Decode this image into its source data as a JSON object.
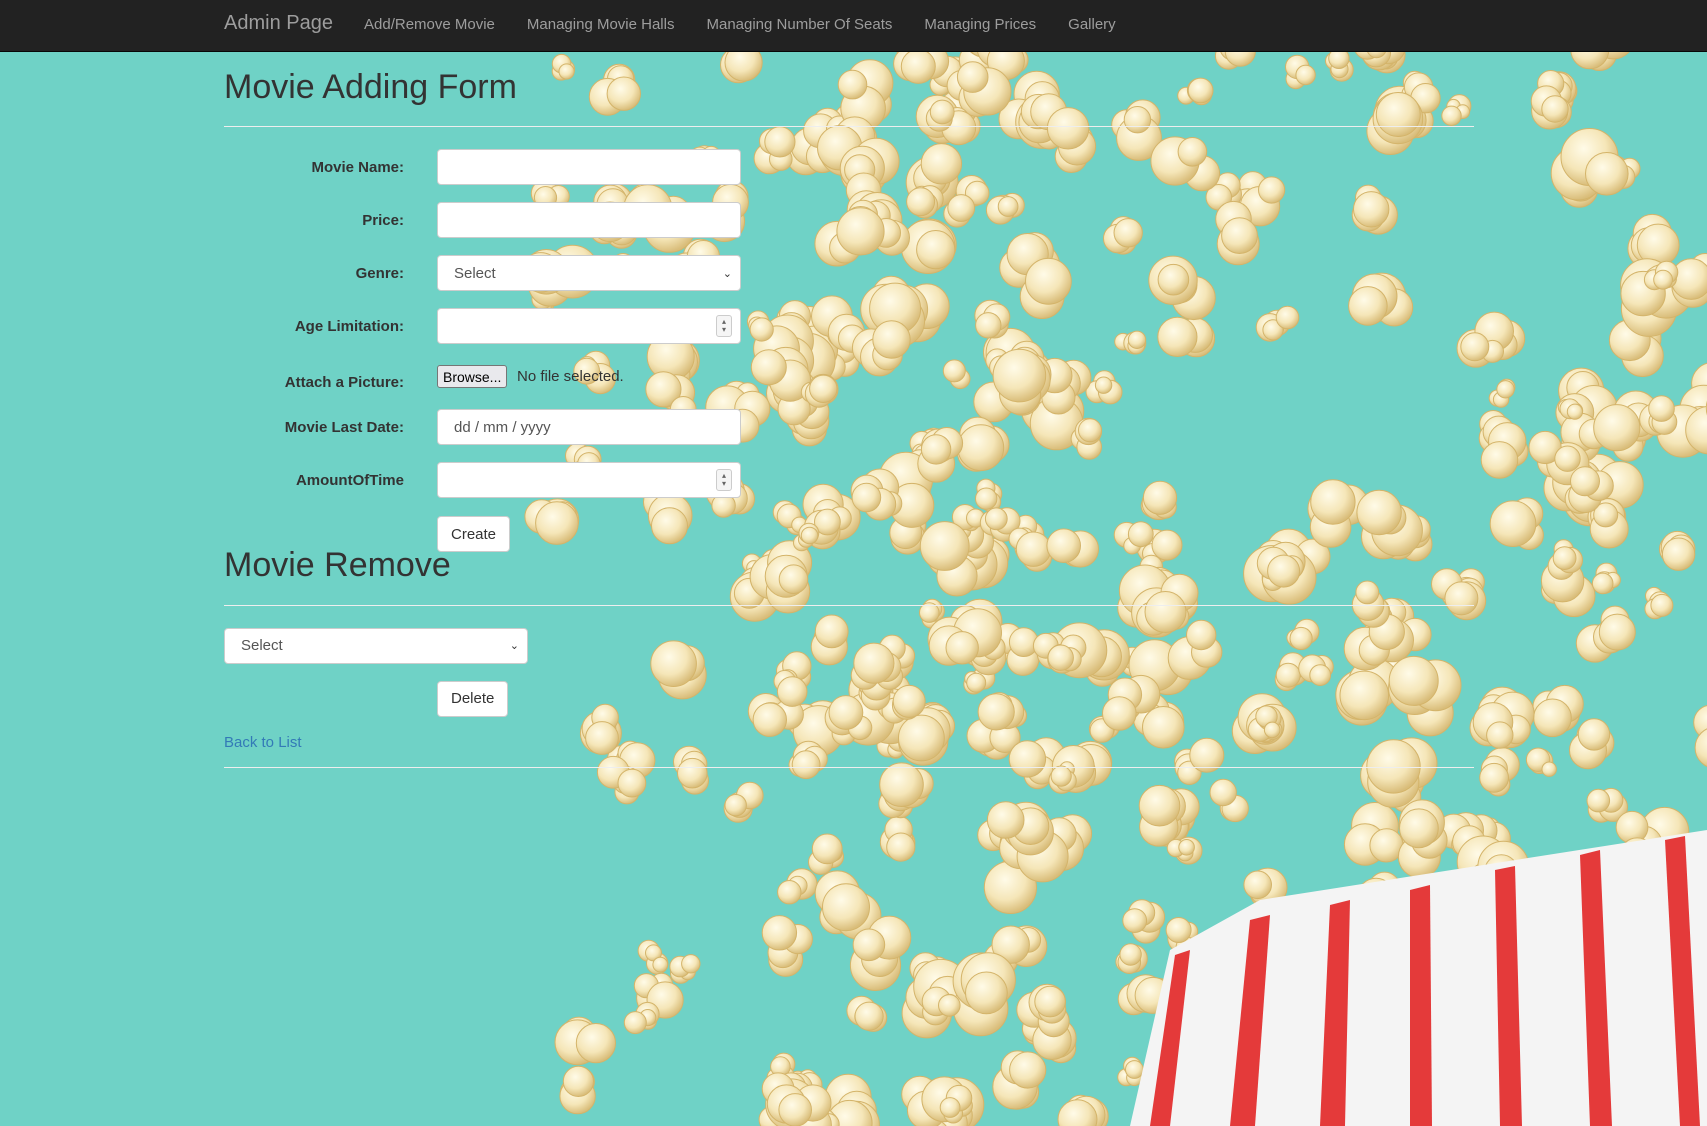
{
  "nav": {
    "brand": "Admin Page",
    "links": [
      "Add/Remove Movie",
      "Managing Movie Halls",
      "Managing Number Of Seats",
      "Managing Prices",
      "Gallery"
    ]
  },
  "add_form": {
    "title": "Movie Adding Form",
    "labels": {
      "movie_name": "Movie Name:",
      "price": "Price:",
      "genre": "Genre:",
      "age_limitation": "Age Limitation:",
      "attach_picture": "Attach a Picture:",
      "movie_last_date": "Movie Last Date:",
      "amount_of_time": "AmountOfTime"
    },
    "values": {
      "movie_name": "",
      "price": "",
      "genre": "Select",
      "age_limitation": "",
      "movie_last_date_placeholder": "dd / mm / yyyy",
      "amount_of_time": ""
    },
    "file": {
      "browse_label": "Browse...",
      "status": "No file selected."
    },
    "create_label": "Create"
  },
  "remove_form": {
    "title": "Movie Remove",
    "select_value": "Select",
    "delete_label": "Delete"
  },
  "back_link": "Back to List",
  "colors": {
    "background": "#6fd2c6",
    "navbar": "#222222",
    "link": "#337ab7"
  }
}
